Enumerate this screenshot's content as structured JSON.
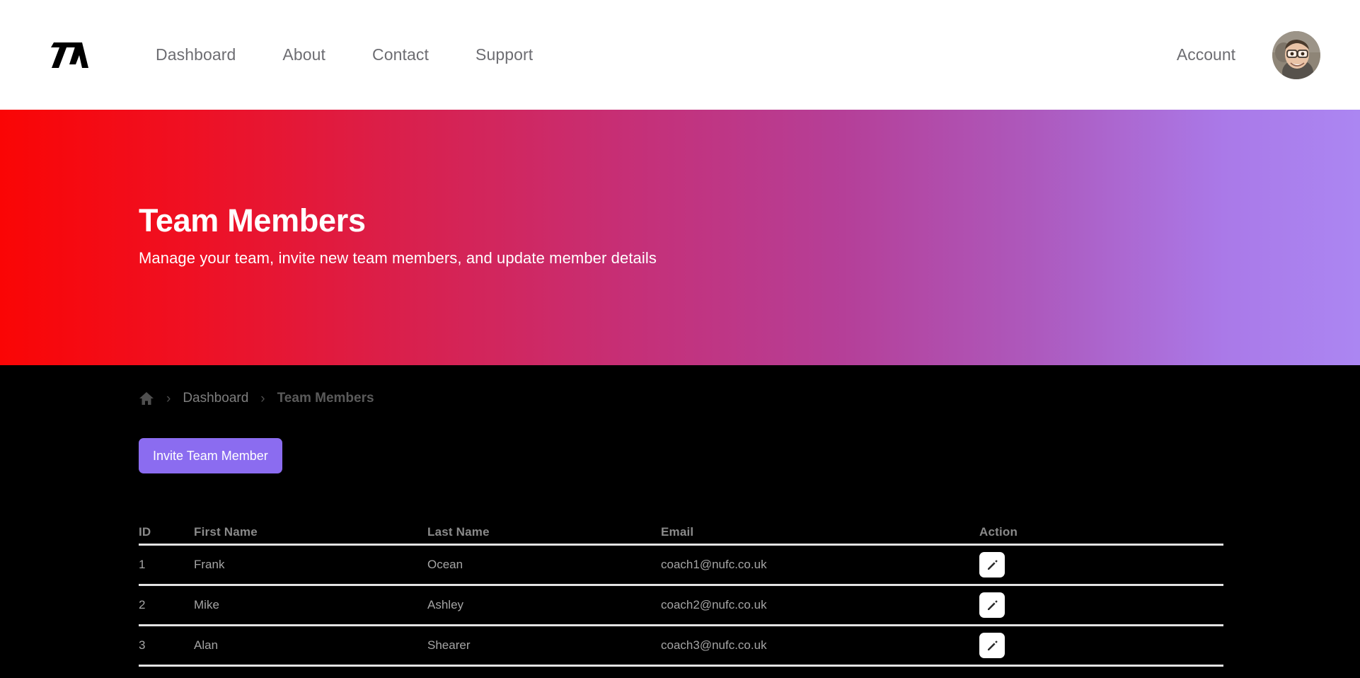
{
  "header": {
    "logo_alt": "TA",
    "nav": [
      {
        "label": "Dashboard"
      },
      {
        "label": "About"
      },
      {
        "label": "Contact"
      },
      {
        "label": "Support"
      }
    ],
    "account_label": "Account"
  },
  "hero": {
    "title": "Team Members",
    "subtitle": "Manage your team, invite new team members, and update member details",
    "gradient_from": "#fa0505",
    "gradient_to": "#ab86f2"
  },
  "breadcrumb": {
    "home_icon": "home-icon",
    "separator": "›",
    "items": [
      {
        "label": "Dashboard"
      },
      {
        "label": "Team Members"
      }
    ]
  },
  "actions": {
    "invite_label": "Invite Team Member",
    "invite_color": "#8b6cf0"
  },
  "table": {
    "columns": [
      "ID",
      "First Name",
      "Last Name",
      "Email",
      "Action"
    ],
    "rows": [
      {
        "id": "1",
        "first": "Frank",
        "last": "Ocean",
        "email": "coach1@nufc.co.uk",
        "action_icon": "edit-pencil-icon"
      },
      {
        "id": "2",
        "first": "Mike",
        "last": "Ashley",
        "email": "coach2@nufc.co.uk",
        "action_icon": "edit-pencil-icon"
      },
      {
        "id": "3",
        "first": "Alan",
        "last": "Shearer",
        "email": "coach3@nufc.co.uk",
        "action_icon": "edit-pencil-icon"
      }
    ]
  }
}
